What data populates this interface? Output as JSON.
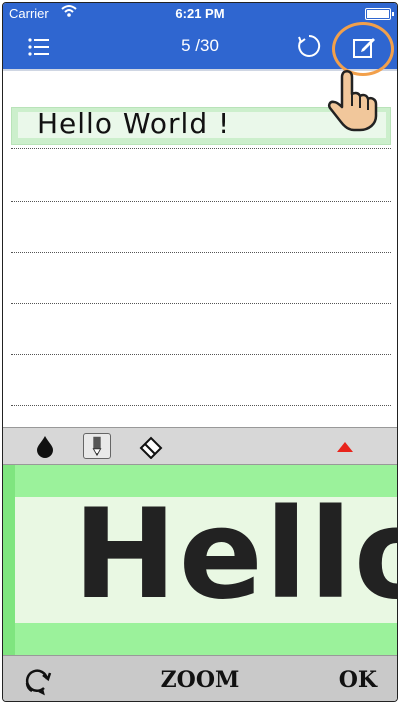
{
  "status": {
    "carrier": "Carrier",
    "time": "6:21 PM"
  },
  "navbar": {
    "counter": "5 /30"
  },
  "page": {
    "line1_text": "Hello World !"
  },
  "pad": {
    "zoom_text": "Hello"
  },
  "bottombar": {
    "zoom_label": "ZOOM",
    "ok_label": "OK"
  },
  "colors": {
    "accent": "#2f66d0",
    "highlight": "#f2a04b",
    "guide_green": "#9bf29b"
  }
}
